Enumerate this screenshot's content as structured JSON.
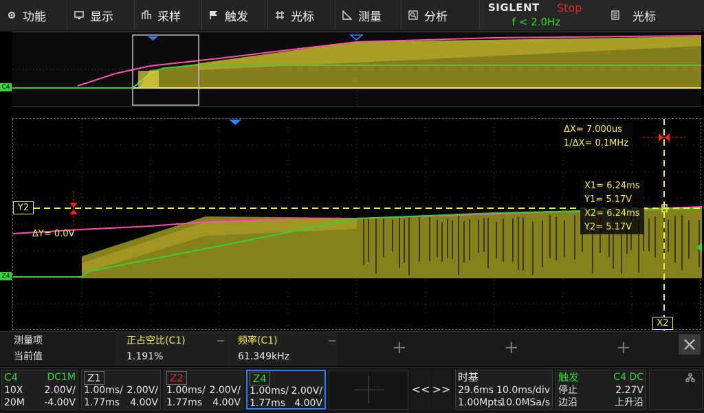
{
  "menu": {
    "items": [
      {
        "label": "功能",
        "icon": "gear-icon"
      },
      {
        "label": "显示",
        "icon": "monitor-icon"
      },
      {
        "label": "采样",
        "icon": "sampling-icon"
      },
      {
        "label": "触发",
        "icon": "flag-icon"
      },
      {
        "label": "光标",
        "icon": "crosshair-icon"
      },
      {
        "label": "测量",
        "icon": "ruler-icon"
      },
      {
        "label": "分析",
        "icon": "magnifier-icon"
      }
    ],
    "brand": "SIGLENT",
    "run_state": "Stop",
    "trigger_frequency": "f < 2.0Hz",
    "cursor_menu_label": "光标",
    "cursor_menu_icon": "list-icon"
  },
  "overview": {
    "channel_marker": "C4"
  },
  "main": {
    "channel_marker": "Z4",
    "cursor_y_tag": "Y2",
    "cursor_x_tag": "X2",
    "delta_y": "ΔY= 0.0V",
    "delta_x": "ΔX= 7.000us",
    "inv_delta_x": "1/ΔX= 0.1MHz",
    "x1": "X1= 6.24ms",
    "y1": "Y1= 5.17V",
    "x2": "X2= 6.24ms",
    "y2": "Y2= 5.17V"
  },
  "measurements": {
    "label_header": "测量项",
    "label_current": "当前值",
    "items": [
      {
        "name": "正占空比(C1)",
        "value": "1.191%"
      },
      {
        "name": "频率(C1)",
        "value": "61.349kHz"
      }
    ],
    "close_icon": "close-icon"
  },
  "status": {
    "c4": {
      "name": "C4",
      "coupling": "DC1M",
      "probe": "10X",
      "scale": "2.00V/",
      "bandwidth": "20M",
      "offset": "-4.00V"
    },
    "z1": {
      "name": "Z1",
      "time_scale": "1.00ms/",
      "volt_scale": "2.00V/",
      "delay": "1.77ms",
      "offset": "4.00V"
    },
    "z2": {
      "name": "Z2",
      "time_scale": "1.00ms/",
      "volt_scale": "2.00V/",
      "delay": "1.77ms",
      "offset": "4.00V"
    },
    "z4": {
      "name": "Z4",
      "time_scale": "1.00ms/",
      "volt_scale": "2.00V/",
      "delay": "1.77ms",
      "offset": "4.00V"
    },
    "nav_prev": "<<",
    "nav_next": ">>",
    "timebase": {
      "title": "时基",
      "delay": "29.6ms",
      "scale": "10.0ms/div",
      "memory": "1.00Mpts",
      "sample_rate": "10.0MSa/s"
    },
    "trigger": {
      "title": "触发",
      "source": "C4 DC",
      "state": "停止",
      "level": "2.27V",
      "type": "边沿",
      "slope": "上升沿"
    },
    "menu_icon": "hierarchy-icon"
  },
  "colors": {
    "yellow": "#f4ee4a",
    "green": "#32d238",
    "pink": "#ff4fb0",
    "red": "#ff2020",
    "z2_red": "#e02a2a",
    "blue": "#2f80ff"
  }
}
